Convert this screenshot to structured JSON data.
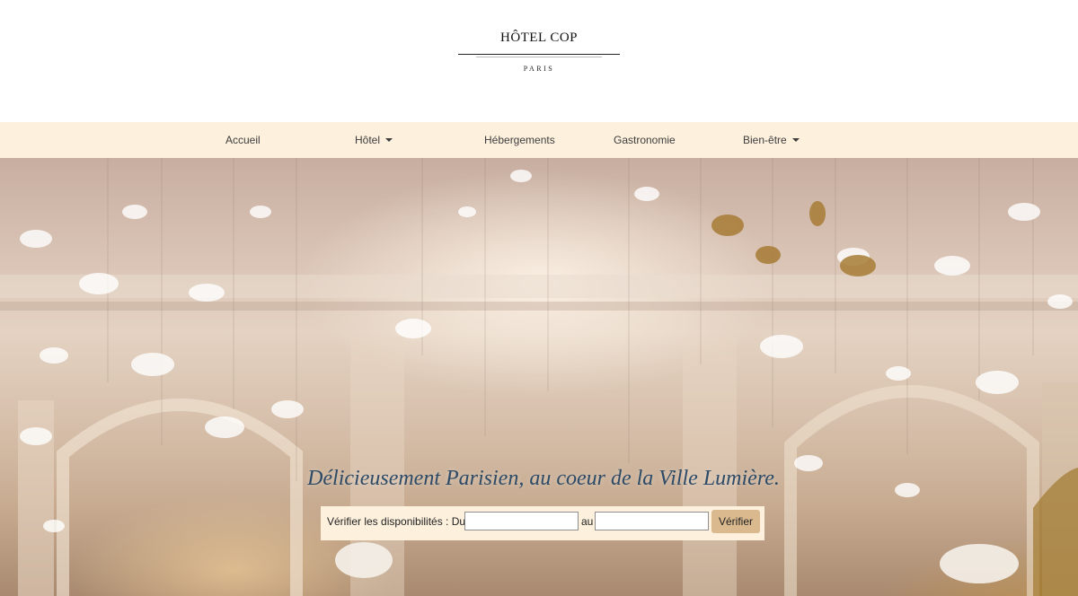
{
  "brand": {
    "name": "HÔTEL COP",
    "city": "PARIS"
  },
  "nav": {
    "items": [
      {
        "label": "Accueil",
        "dropdown": false
      },
      {
        "label": "Hôtel",
        "dropdown": true
      },
      {
        "label": "Hébergements",
        "dropdown": false
      },
      {
        "label": "Gastronomie",
        "dropdown": false
      },
      {
        "label": "Bien-être",
        "dropdown": true
      }
    ]
  },
  "hero": {
    "tagline": "Délicieusement Parisien, au coeur de la Ville Lumière."
  },
  "booking": {
    "label": "Vérifier les disponibilités : Du",
    "from_value": "",
    "separator": "au",
    "to_value": "",
    "button_label": "Vérifier"
  },
  "colors": {
    "nav_background": "#fdf0dd",
    "tagline": "#2d4a66",
    "button": "#dbb98f"
  }
}
